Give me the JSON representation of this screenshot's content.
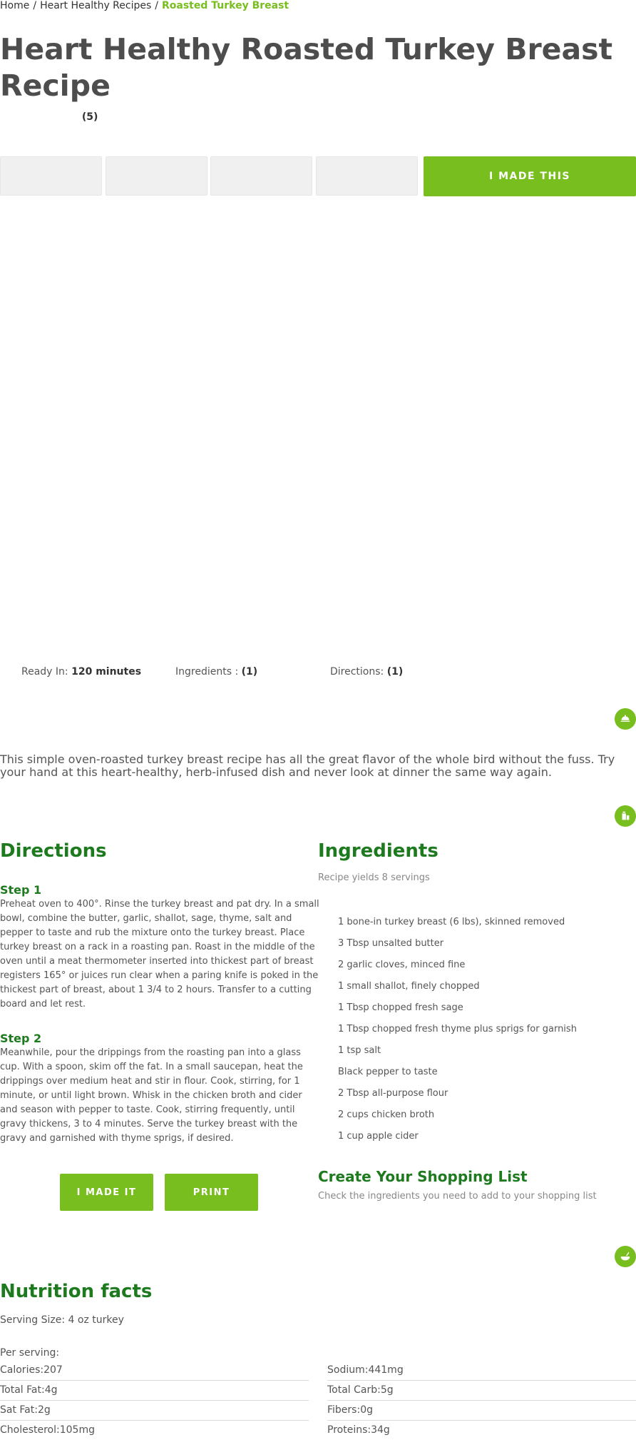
{
  "breadcrumb": {
    "home": "Home",
    "separator": "/",
    "parent": "Heart Healthy Recipes",
    "current": "Roasted Turkey Breast"
  },
  "title": "Heart Healthy Roasted Turkey Breast Recipe",
  "rating": {
    "count": "(5)"
  },
  "actions": {
    "made_this_top": "I MADE THIS"
  },
  "meta": {
    "ready_label": "Ready In:",
    "ready_value": "120 minutes",
    "ingredients_label": "Ingredients :",
    "ingredients_value": "(1)",
    "directions_label": "Directions:",
    "directions_value": "(1)"
  },
  "icons": {
    "description_icon": "dish-icon",
    "ingredients_icon": "ingredients-icon",
    "nutrition_icon": "bowl-icon"
  },
  "colors": {
    "accent": "#78be1e",
    "heading": "#1e7a1e",
    "text": "#555555",
    "button_gray": "#f0f0f0"
  },
  "description": "This simple oven-roasted turkey breast recipe has all the great flavor of the whole bird without the fuss. Try your hand at this heart-healthy, herb-infused dish and never look at dinner the same way again.",
  "directions": {
    "heading": "Directions",
    "steps": [
      {
        "title": "Step 1",
        "text": "Preheat oven to 400°. Rinse the turkey breast and pat dry. In a small bowl, combine the butter, garlic, shallot, sage, thyme, salt and pepper to taste and rub the mixture onto the turkey breast. Place turkey breast on a rack in a roasting pan. Roast in the middle of the oven until a meat thermometer inserted into thickest part of breast registers 165° or juices run clear when a paring knife is poked in the thickest part of breast, about 1 3/4 to 2 hours. Transfer to a cutting board and let rest."
      },
      {
        "title": "Step 2",
        "text": "Meanwhile, pour the drippings from the roasting pan into a glass cup. With a spoon, skim off the fat. In a small saucepan, heat the drippings over medium heat and stir in flour. Cook, stirring, for 1 minute, or until light brown. Whisk in the chicken broth and cider and season with pepper to taste. Cook, stirring frequently, until gravy thickens, 3 to 4 minutes. Serve the turkey breast with the gravy and garnished with thyme sprigs, if desired."
      }
    ],
    "made_it_button": "I MADE IT",
    "print_button": "PRINT"
  },
  "ingredients": {
    "heading": "Ingredients",
    "yields": "Recipe yields 8 servings",
    "items": [
      "1 bone-in turkey breast (6 lbs), skinned removed",
      "3 Tbsp unsalted butter",
      "2 garlic cloves, minced fine",
      "1 small shallot, finely chopped",
      "1 Tbsp chopped fresh sage",
      "1 Tbsp chopped fresh thyme plus sprigs for garnish",
      "1 tsp salt",
      "Black pepper to taste",
      "2 Tbsp all-purpose flour",
      "2 cups chicken broth",
      "1 cup apple cider"
    ]
  },
  "shopping": {
    "heading": "Create Your Shopping List",
    "note": "Check the ingredients you need to add to your shopping list"
  },
  "nutrition": {
    "heading": "Nutrition facts",
    "serving_size": "Serving Size: 4 oz turkey",
    "per_serving": "Per serving:",
    "left": [
      "Calories:207",
      "Total Fat:4g",
      "Sat Fat:2g",
      "Cholesterol:105mg"
    ],
    "right": [
      "Sodium:441mg",
      "Total Carb:5g",
      "Fibers:0g",
      "Proteins:34g"
    ]
  }
}
